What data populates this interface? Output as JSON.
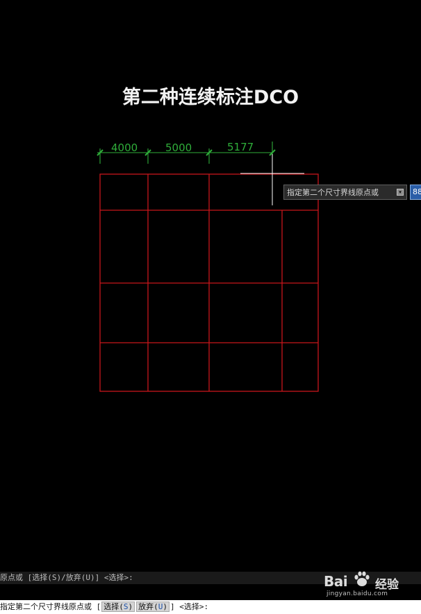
{
  "title": "第二种连续标注DCO",
  "dimensions": {
    "labels": [
      "4000",
      "5000",
      "5177"
    ],
    "line_color": "#2fae3a",
    "text_color": "#2fae3a"
  },
  "grid": {
    "line_color": "#c8161b"
  },
  "tooltip": {
    "prompt": "指定第二个尺寸界线原点或",
    "down_button": "▾",
    "input_value": "88"
  },
  "command": {
    "history": "原点或 [选择(S)/放弃(U)] <选择>:",
    "prompt_prefix": "指定第二个尺寸界线原点或 [",
    "opt1_pre": "选择(",
    "opt1_key": "S",
    "opt1_post": ")",
    "opt2_pre": "放弃(",
    "opt2_key": "U",
    "opt2_post": ")",
    "prompt_suffix": "] <选择>:"
  },
  "watermark": {
    "brand": "Bai",
    "brand2": "经验",
    "url": "jingyan.baidu.com"
  },
  "colors": {
    "background": "#000000",
    "cursor": "#ffffff"
  }
}
